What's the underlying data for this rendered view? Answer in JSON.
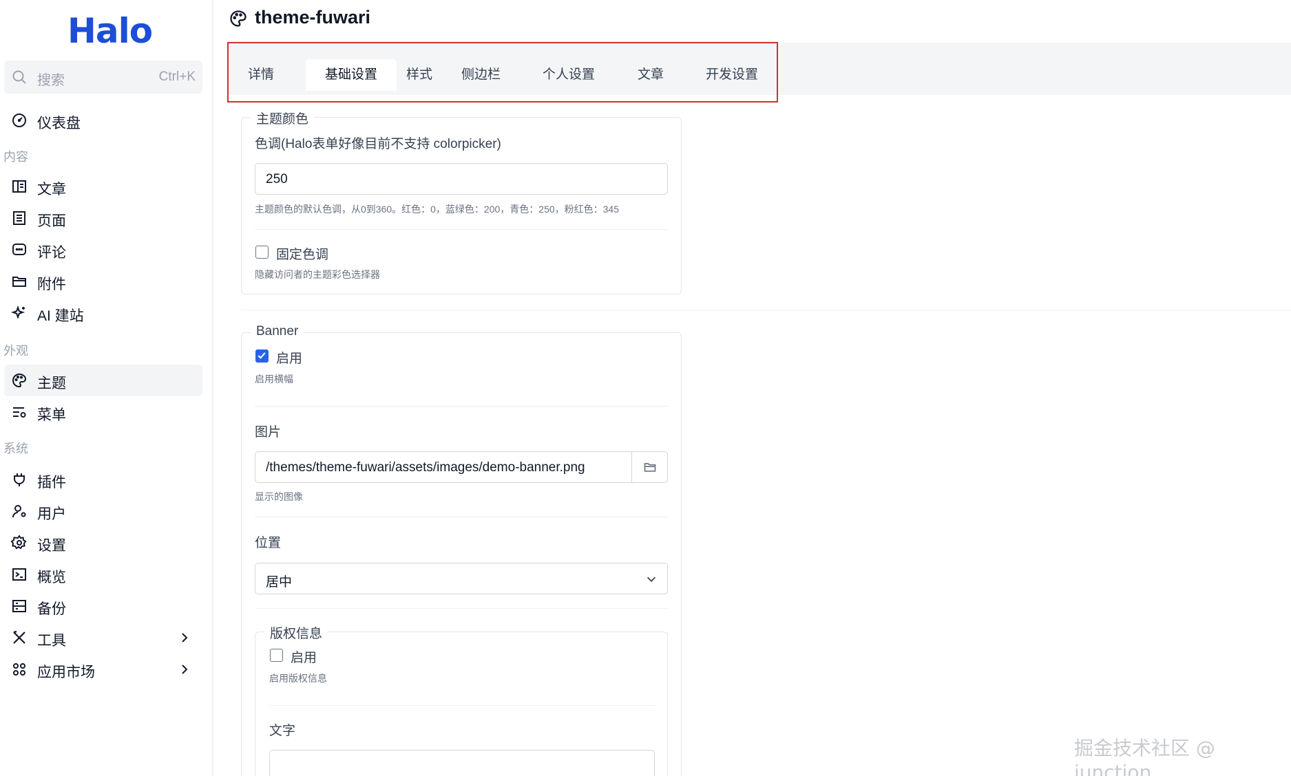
{
  "sidebar": {
    "logo": "Halo",
    "search": {
      "placeholder": "搜索",
      "shortcut": "Ctrl+K"
    },
    "dashboard": "仪表盘",
    "groups": {
      "content": "内容",
      "appearance": "外观",
      "system": "系统"
    },
    "content_items": [
      "文章",
      "页面",
      "评论",
      "附件",
      "AI 建站"
    ],
    "appearance_items": [
      "主题",
      "菜单"
    ],
    "system_items": [
      "插件",
      "用户",
      "设置",
      "概览",
      "备份",
      "工具",
      "应用市场"
    ]
  },
  "header": {
    "title": "theme-fuwari"
  },
  "tabs": [
    "详情",
    "基础设置",
    "样式",
    "侧边栏",
    "个人设置",
    "文章",
    "开发设置"
  ],
  "active_tab": "基础设置",
  "theme_color": {
    "legend": "主题颜色",
    "hue_label": "色调(Halo表单好像目前不支持 colorpicker)",
    "hue_value": "250",
    "hue_help": "主题颜色的默认色调，从0到360。红色：0，蓝绿色：200，青色：250，粉红色：345",
    "fixed_label": "固定色调",
    "fixed_checked": false,
    "fixed_help": "隐藏访问者的主题彩色选择器"
  },
  "banner": {
    "legend": "Banner",
    "enable_label": "启用",
    "enable_checked": true,
    "enable_help": "启用横幅",
    "image_label": "图片",
    "image_value": "/themes/theme-fuwari/assets/images/demo-banner.png",
    "image_help": "显示的图像",
    "position_label": "位置",
    "position_value": "居中",
    "copyright": {
      "legend": "版权信息",
      "enable_label": "启用",
      "enable_checked": false,
      "enable_help": "启用版权信息",
      "text_label": "文字"
    }
  },
  "watermark": "掘金技术社区 @ junction",
  "colors": {
    "accent": "#2563eb",
    "highlight_border": "#d0312d",
    "logo": "#1d4ed8"
  }
}
